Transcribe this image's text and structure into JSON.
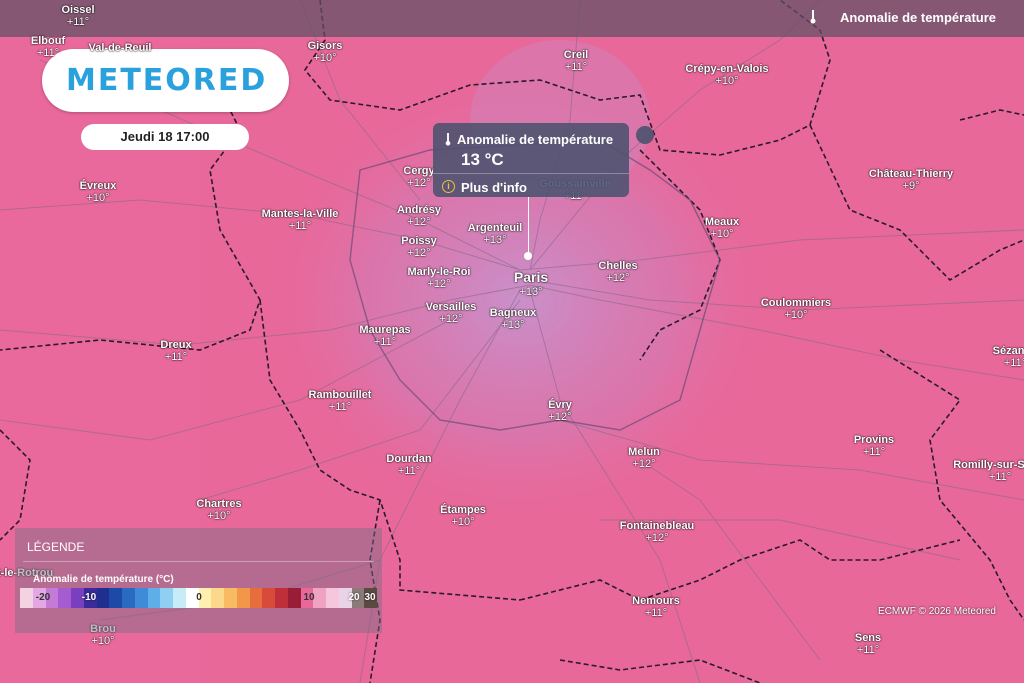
{
  "header": {
    "title": "Anomalie de température"
  },
  "logo": {
    "text": "METEORED"
  },
  "datetime": "Jeudi 18 17:00",
  "popup": {
    "title": "Anomalie de température",
    "value": "13 °C",
    "link": "Plus d'info"
  },
  "cities": [
    {
      "name": "Oissel",
      "value": "+11°"
    },
    {
      "name": "Elbouf",
      "value": "+11°"
    },
    {
      "name": "Val-de-Reuil",
      "value": ""
    },
    {
      "name": "Gisors",
      "value": "+10°"
    },
    {
      "name": "Creil",
      "value": "+11°"
    },
    {
      "name": "Crépy-en-Valois",
      "value": "+10°"
    },
    {
      "name": "Évreux",
      "value": "+10°"
    },
    {
      "name": "Cergy",
      "value": "+12°"
    },
    {
      "name": "Goussainville",
      "value": "+11°"
    },
    {
      "name": "Château-Thierry",
      "value": "+9°"
    },
    {
      "name": "Mantes-la-Ville",
      "value": "+11°"
    },
    {
      "name": "Andrésy",
      "value": "+12°"
    },
    {
      "name": "Meaux",
      "value": "+10°"
    },
    {
      "name": "Argenteuil",
      "value": "+13°"
    },
    {
      "name": "Poissy",
      "value": "+12°"
    },
    {
      "name": "Chelles",
      "value": "+12°"
    },
    {
      "name": "Marly-le-Roi",
      "value": "+12°"
    },
    {
      "name": "Paris",
      "value": "+13°"
    },
    {
      "name": "Coulommiers",
      "value": "+10°"
    },
    {
      "name": "Versailles",
      "value": "+12°"
    },
    {
      "name": "Bagneux",
      "value": "+13°"
    },
    {
      "name": "Maurepas",
      "value": "+11°"
    },
    {
      "name": "Dreux",
      "value": "+11°"
    },
    {
      "name": "Sézanne",
      "value": "+11°"
    },
    {
      "name": "Rambouillet",
      "value": "+11°"
    },
    {
      "name": "Évry",
      "value": "+12°"
    },
    {
      "name": "Provins",
      "value": "+11°"
    },
    {
      "name": "Dourdan",
      "value": "+11°"
    },
    {
      "name": "Melun",
      "value": "+12°"
    },
    {
      "name": "Romilly-sur-Seine",
      "value": "+11°"
    },
    {
      "name": "Chartres",
      "value": "+10°"
    },
    {
      "name": "Étampes",
      "value": "+10°"
    },
    {
      "name": "Fontainebleau",
      "value": "+12°"
    },
    {
      "name": "Nogent-le-Rotrou",
      "value": ""
    },
    {
      "name": "Nemours",
      "value": "+11°"
    },
    {
      "name": "Brou",
      "value": "+10°"
    },
    {
      "name": "Sens",
      "value": "+11°"
    }
  ],
  "legend": {
    "title": "LÉGENDE",
    "subtitle": "Anomalie de température (°C)",
    "ticks": [
      "-20",
      "-10",
      "0",
      "10",
      "20",
      "30"
    ],
    "colors": [
      "#f3d2e1",
      "#e3a7e4",
      "#c67ad8",
      "#a65cd0",
      "#7a3fbf",
      "#3a2a9a",
      "#1e2f8f",
      "#1d4aa8",
      "#2a6ac0",
      "#3f8bd8",
      "#5eaee8",
      "#8fd0f2",
      "#c5ecf7",
      "#ffffff",
      "#fff0b0",
      "#fcd98a",
      "#f8bb64",
      "#f2974a",
      "#e76d3c",
      "#d84b3a",
      "#bf2f3a",
      "#9a1c36",
      "#e8689a",
      "#f0a2c2",
      "#f6c6dc",
      "#e9d3e6",
      "#8c7a7a",
      "#5a4a40"
    ]
  },
  "attribution": "ECMWF © 2026 Meteored",
  "colors": {
    "map_base": "#e8689a",
    "center_tint": "#c78ec8",
    "header_bg": "#5f5064"
  }
}
